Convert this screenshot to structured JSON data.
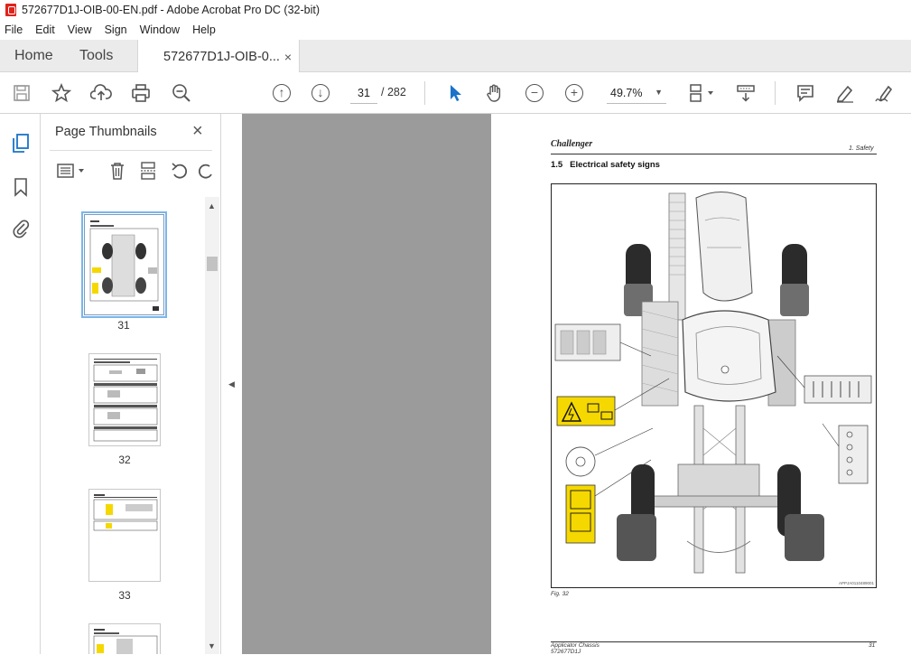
{
  "window": {
    "title": "572677D1J-OIB-00-EN.pdf - Adobe Acrobat Pro DC (32-bit)"
  },
  "menu": [
    "File",
    "Edit",
    "View",
    "Sign",
    "Window",
    "Help"
  ],
  "tabs": {
    "home": "Home",
    "tools": "Tools",
    "document": "572677D1J-OIB-0...",
    "close": "×"
  },
  "toolbar": {
    "current_page": "31",
    "total_pages": "/ 282",
    "zoom": "49.7%"
  },
  "panel": {
    "title": "Page Thumbnails",
    "close": "×"
  },
  "thumbnails": [
    {
      "label": "31"
    },
    {
      "label": "32"
    },
    {
      "label": "33"
    }
  ],
  "page": {
    "brand": "Challenger",
    "chapter": "1. Safety",
    "section": "1.5   Electrical safety signs",
    "figure_code": "APPJA0110489001",
    "figure_caption": "Fig. 32",
    "footer_title": "Applicator Chassis",
    "footer_code": "572677D1J",
    "footer_page": "31"
  },
  "colors": {
    "accent": "#e0231b",
    "viewer_bg": "#9b9b9b",
    "warning_yellow": "#f5d800",
    "nav_blue": "#1a73c9"
  }
}
